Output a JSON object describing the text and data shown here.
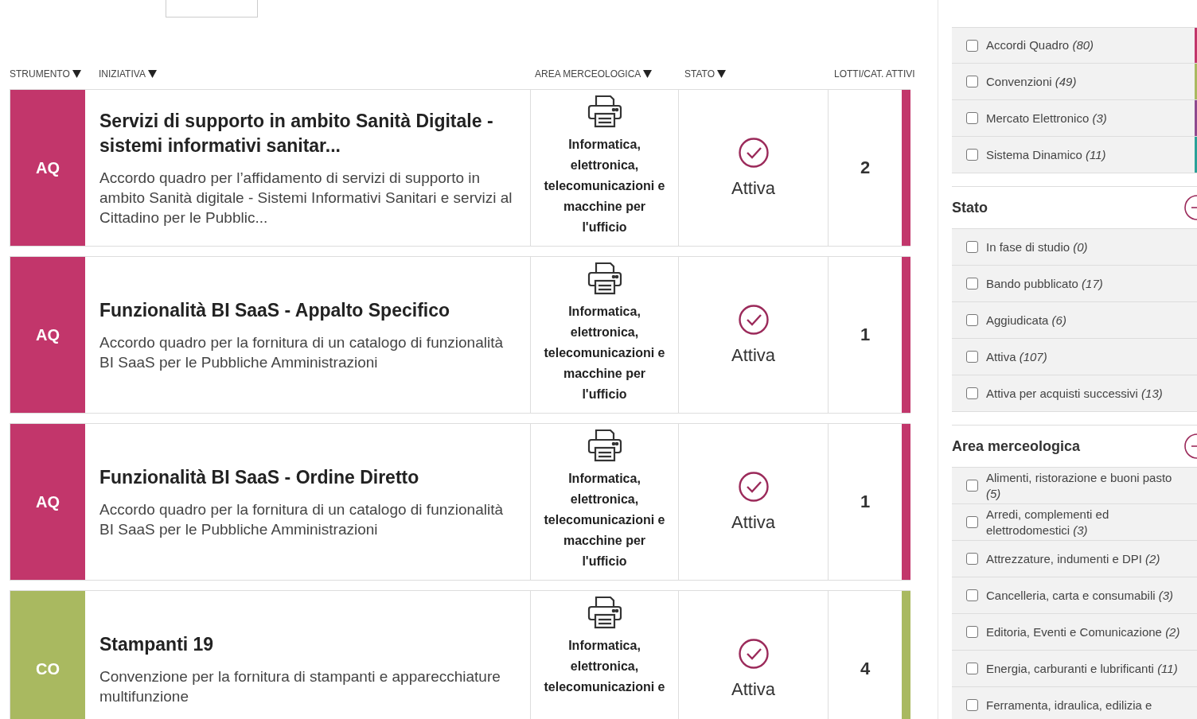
{
  "columns": [
    {
      "label": "STRUMENTO",
      "sortable": true
    },
    {
      "label": "INIZIATIVA",
      "sortable": true
    },
    {
      "label": "AREA MERCEOLOGICA",
      "sortable": true
    },
    {
      "label": "STATO",
      "sortable": true
    },
    {
      "label": "LOTTI/CAT. ATTIVI",
      "sortable": false
    }
  ],
  "rows": [
    {
      "tag": "AQ",
      "color": "#c2366b",
      "title": "Servizi di supporto in ambito Sanità Digitale - sistemi informativi sanitar...",
      "description": "Accordo quadro per l’affidamento di servizi di supporto in ambito Sanità digitale - Sistemi Informativi Sanitari e servizi al Cittadino per le Pubblic...",
      "area": "Informatica, elettronica, telecomunicazioni e macchine per l'ufficio",
      "status": "Attiva",
      "lots": "2"
    },
    {
      "tag": "AQ",
      "color": "#c2366b",
      "title": "Funzionalità BI SaaS - Appalto Specifico",
      "description": "Accordo quadro per la fornitura di un catalogo di funzionalità BI SaaS per le Pubbliche Amministrazioni",
      "area": "Informatica, elettronica, telecomunicazioni e macchine per l'ufficio",
      "status": "Attiva",
      "lots": "1"
    },
    {
      "tag": "AQ",
      "color": "#c2366b",
      "title": "Funzionalità BI SaaS - Ordine Diretto",
      "description": "Accordo quadro per la fornitura di un catalogo di funzionalità BI SaaS per le Pubbliche Amministrazioni",
      "area": "Informatica, elettronica, telecomunicazioni e macchine per l'ufficio",
      "status": "Attiva",
      "lots": "1"
    },
    {
      "tag": "CO",
      "color": "#a9b960",
      "title": "Stampanti 19",
      "description": "Convenzione per la fornitura di stampanti e apparecchiature multifunzione",
      "area": "Informatica, elettronica, telecomunicazioni e",
      "status": "Attiva",
      "lots": "4"
    }
  ],
  "strumento_options": [
    {
      "label": "Accordi Quadro",
      "count": "(80)",
      "checked": false,
      "color": "#c2366b"
    },
    {
      "label": "Convenzioni",
      "count": "(49)",
      "checked": false,
      "color": "#a9b960"
    },
    {
      "label": "Mercato Elettronico",
      "count": "(3)",
      "checked": false,
      "color": "#8e4a8f"
    },
    {
      "label": "Sistema Dinamico",
      "count": "(11)",
      "checked": false,
      "color": "#2aa198"
    }
  ],
  "sections": [
    {
      "title": "Stato",
      "options": [
        {
          "label": "In fase di studio",
          "count": "(0)",
          "checked": false
        },
        {
          "label": "Bando pubblicato",
          "count": "(17)",
          "checked": false
        },
        {
          "label": "Aggiudicata",
          "count": "(6)",
          "checked": false
        },
        {
          "label": "Attiva",
          "count": "(107)",
          "checked": false
        },
        {
          "label": "Attiva per acquisti successivi",
          "count": "(13)",
          "checked": false
        }
      ]
    },
    {
      "title": "Area merceologica",
      "options": [
        {
          "label": "Alimenti, ristorazione e buoni pasto",
          "count": "(5)",
          "checked": false
        },
        {
          "label": "Arredi, complementi ed elettrodomestici",
          "count": "(3)",
          "checked": false
        },
        {
          "label": "Attrezzature, indumenti e DPI",
          "count": "(2)",
          "checked": false
        },
        {
          "label": "Cancelleria, carta e consumabili",
          "count": "(3)",
          "checked": false
        },
        {
          "label": "Editoria, Eventi e Comunicazione",
          "count": "(2)",
          "checked": false
        },
        {
          "label": "Energia, carburanti e lubrificanti",
          "count": "(11)",
          "checked": false
        },
        {
          "label": "Ferramenta, idraulica, edilizia e",
          "checked": false
        }
      ]
    }
  ]
}
